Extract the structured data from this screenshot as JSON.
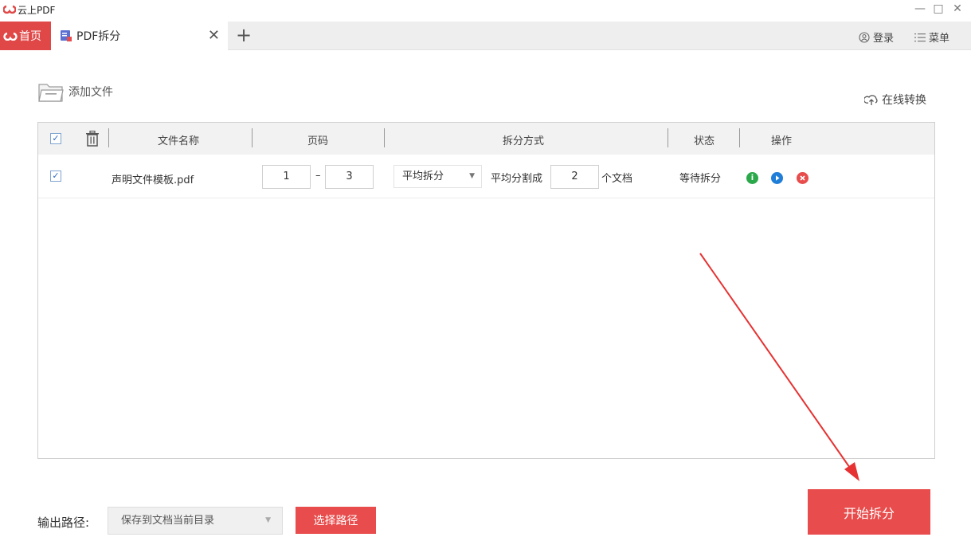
{
  "window": {
    "title": "云上PDF",
    "minimize": "—",
    "maximize": "□",
    "close": "✕"
  },
  "tabs": {
    "home_label": "首页",
    "active_label": "PDF拆分",
    "close_glyph": "✕",
    "add_glyph": "+"
  },
  "header": {
    "login_label": "登录",
    "menu_label": "菜单"
  },
  "toolbar": {
    "add_file_label": "添加文件",
    "online_label": "在线转换"
  },
  "table": {
    "columns": [
      "文件名称",
      "页码",
      "拆分方式",
      "状态",
      "操作"
    ],
    "rows": [
      {
        "checked": "✓",
        "filename": "声明文件模板.pdf",
        "page_from": "1",
        "page_dash": "–",
        "page_to": "3",
        "split_mode": "平均拆分",
        "split_prefix": "平均分割成",
        "split_count": "2",
        "split_suffix": "个文档",
        "status": "等待拆分"
      }
    ]
  },
  "header_check": "✓",
  "footer": {
    "output_label": "输出路径:",
    "output_value": "保存到文档当前目录",
    "choose_path_label": "选择路径",
    "start_label": "开始拆分"
  },
  "colors": {
    "accent": "#e84c4c",
    "info": "#2aa84a",
    "play": "#1f7ed8",
    "remove": "#e84c4c",
    "arrow": "#e63232"
  }
}
